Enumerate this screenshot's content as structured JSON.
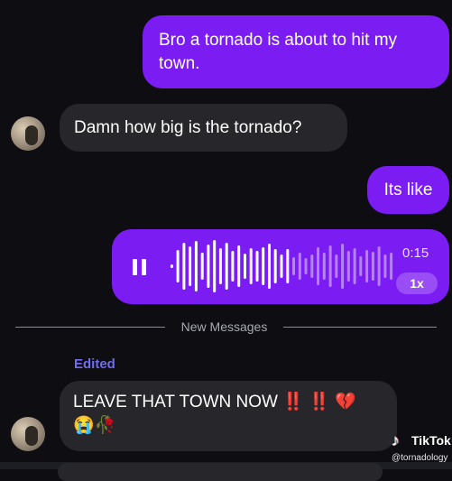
{
  "messages": [
    {
      "id": "m1",
      "sender": "me",
      "text": "Bro a tornado is about to hit my town."
    },
    {
      "id": "m2",
      "sender": "them",
      "text": "Damn how big is the tornado?"
    },
    {
      "id": "m3",
      "sender": "me",
      "text": "Its like"
    }
  ],
  "voice_message": {
    "duration": "0:15",
    "speed": "1x",
    "playback_fraction": 0.53
  },
  "divider": {
    "label": "New Messages"
  },
  "edited_label": "Edited",
  "last_message": {
    "text": "LEAVE THAT TOWN NOW",
    "emoji_line1": "‼️ ‼️ 💔",
    "emoji_line2": "😭🥀"
  },
  "watermark": {
    "brand": "TikTok",
    "handle": "@tornadology"
  },
  "colors": {
    "outgoing_bubble": "#7b1cf2",
    "incoming_bubble": "#26262b",
    "background": "#0d0d12",
    "edited": "#6f6cf0"
  },
  "icons": [
    "pause-icon",
    "tiktok-logo-icon"
  ]
}
